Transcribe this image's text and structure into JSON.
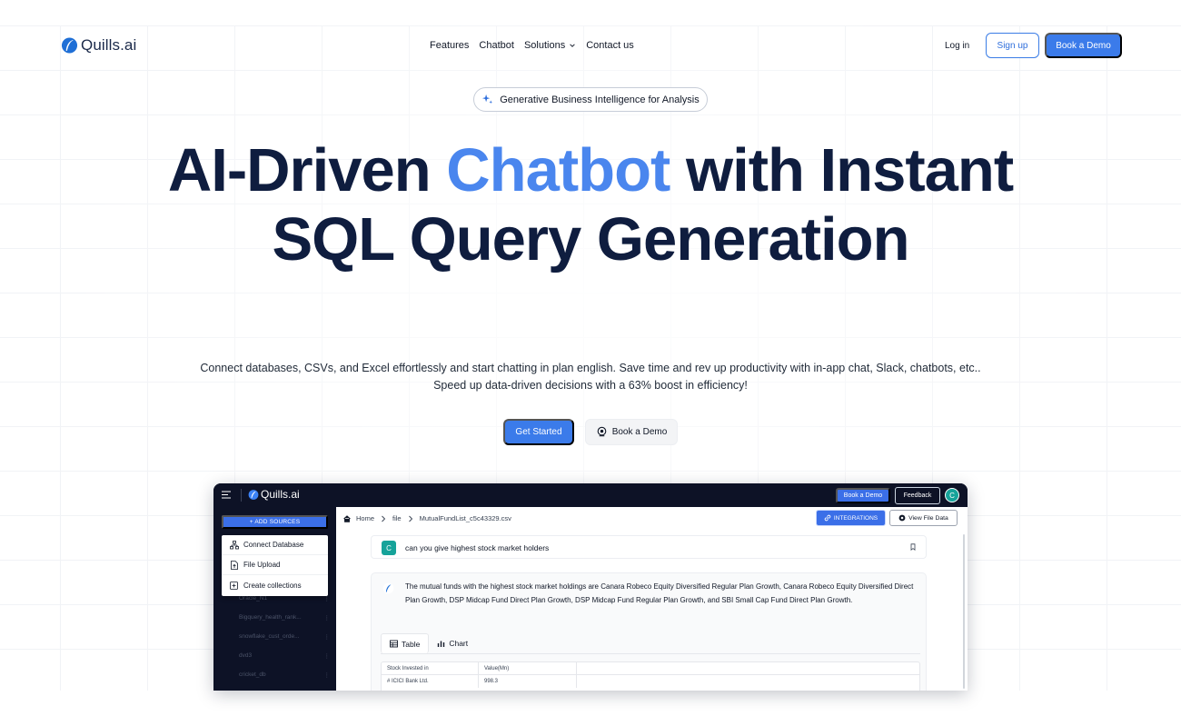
{
  "nav": {
    "logo_text": "Quills.ai",
    "links": [
      {
        "label": "Features"
      },
      {
        "label": "Chatbot"
      },
      {
        "label": "Solutions"
      },
      {
        "label": "Contact us"
      }
    ],
    "login_label": "Log in",
    "signup_label": "Sign up",
    "book_demo_label": "Book a Demo"
  },
  "hero": {
    "pill_label": "Generative Business Intelligence for Analysis",
    "headline_part1": "AI-Driven ",
    "headline_accent": "Chatbot",
    "headline_part2": " with Instant SQL Query Generation",
    "subtext": "Connect databases, CSVs, and Excel effortlessly and start chatting in plan english. Save time and rev up productivity with in-app chat, Slack, chatbots, etc.. Speed up data-driven decisions with a 63% boost in efficiency!",
    "get_started_label": "Get Started",
    "book_demo_label": "Book a Demo"
  },
  "app": {
    "logo_text": "Quills.ai",
    "book_demo_label": "Book a Demo",
    "feedback_label": "Feedback",
    "avatar_initial": "C",
    "add_sources_label": "+ ADD SOURCES",
    "dropdown": [
      {
        "label": "Connect Database"
      },
      {
        "label": "File Upload"
      },
      {
        "label": "Create collections"
      }
    ],
    "sidebar_items": [
      {
        "label": "Oracle_N1"
      },
      {
        "label": "Bigquery_health_rank..."
      },
      {
        "label": "snowflake_cust_orde..."
      },
      {
        "label": "dvd3"
      },
      {
        "label": "cricket_db"
      }
    ],
    "breadcrumb": [
      "Home",
      "file",
      "MutualFundList_c5c43329.csv"
    ],
    "integrations_label": "INTEGRATIONS",
    "view_file_label": "View File Data",
    "question_avatar": "C",
    "question": "can you give highest stock market holders",
    "answer": "The mutual funds with the highest stock market holdings are Canara Robeco Equity Diversified Regular Plan Growth, Canara Robeco Equity Diversified Direct Plan Growth, DSP Midcap Fund Direct Plan Growth, DSP Midcap Fund Regular Plan Growth, and SBI Small Cap Fund Direct Plan Growth.",
    "tabs": [
      {
        "label": "Table"
      },
      {
        "label": "Chart"
      }
    ],
    "table": {
      "headers": [
        "Stock Invested in",
        "Value(Mn)"
      ],
      "rows": [
        [
          "# ICICI Bank Ltd.",
          "998.3"
        ]
      ]
    }
  },
  "colors": {
    "accent": "#3b7bea",
    "headline": "#0f1d3f",
    "headline_accent": "#4a86ee",
    "app_dark": "#0d1226",
    "avatar_teal": "#16a39a"
  }
}
